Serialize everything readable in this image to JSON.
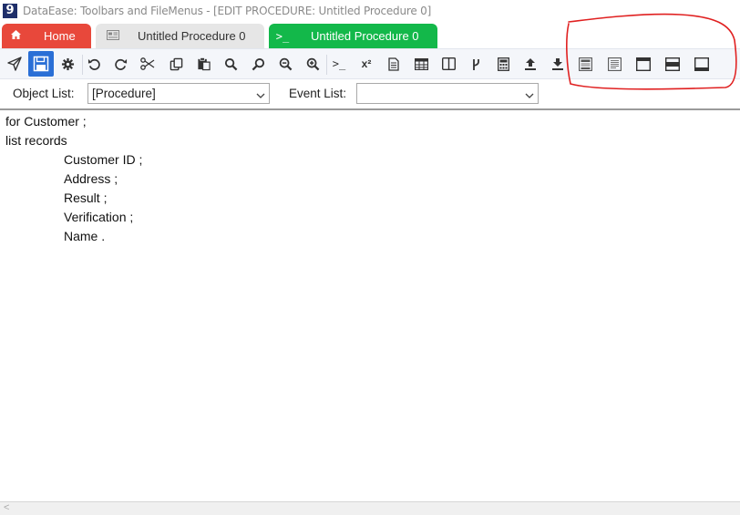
{
  "window": {
    "app_icon": "9",
    "title": "DataEase: Toolbars and FileMenus - [EDIT  PROCEDURE: Untitled Procedure 0]"
  },
  "tabs": [
    {
      "label": "Home",
      "icon": "home-icon",
      "color": "#e8483b"
    },
    {
      "label": "Untitled Procedure 0",
      "icon": "form-icon",
      "color": "#e6e6e6"
    },
    {
      "label": "Untitled Procedure 0",
      "icon": "terminal-icon",
      "icon_text": ">_",
      "color": "#13b84a"
    }
  ],
  "toolbar": {
    "items": [
      "send-icon",
      "save-icon",
      "gear-icon",
      "undo-icon",
      "redo-icon",
      "cut-icon",
      "copy-icon",
      "paste-icon",
      "find-icon",
      "find-next-icon",
      "zoom-out-icon",
      "zoom-in-icon",
      "prompt-icon",
      "superscript-icon",
      "document-icon",
      "table-icon",
      "columns-icon",
      "branch-icon",
      "calculator-icon",
      "upload-icon",
      "download-icon",
      "form-view-icon",
      "text-view-icon",
      "header-section-icon",
      "middle-section-icon",
      "footer-section-icon"
    ],
    "prompt_glyph": ">_",
    "superscript_glyph": "x²",
    "save_color": "#2a6fd6"
  },
  "lists": {
    "object_label": "Object List:",
    "object_value": "[Procedure]",
    "event_label": "Event List:",
    "event_value": ""
  },
  "editor": {
    "lines": [
      "for Customer ;",
      "list records",
      "Customer ID ;",
      "Address ;",
      "Result ;",
      "Verification ;",
      "Name ."
    ]
  },
  "annotation_color": "#e02020"
}
